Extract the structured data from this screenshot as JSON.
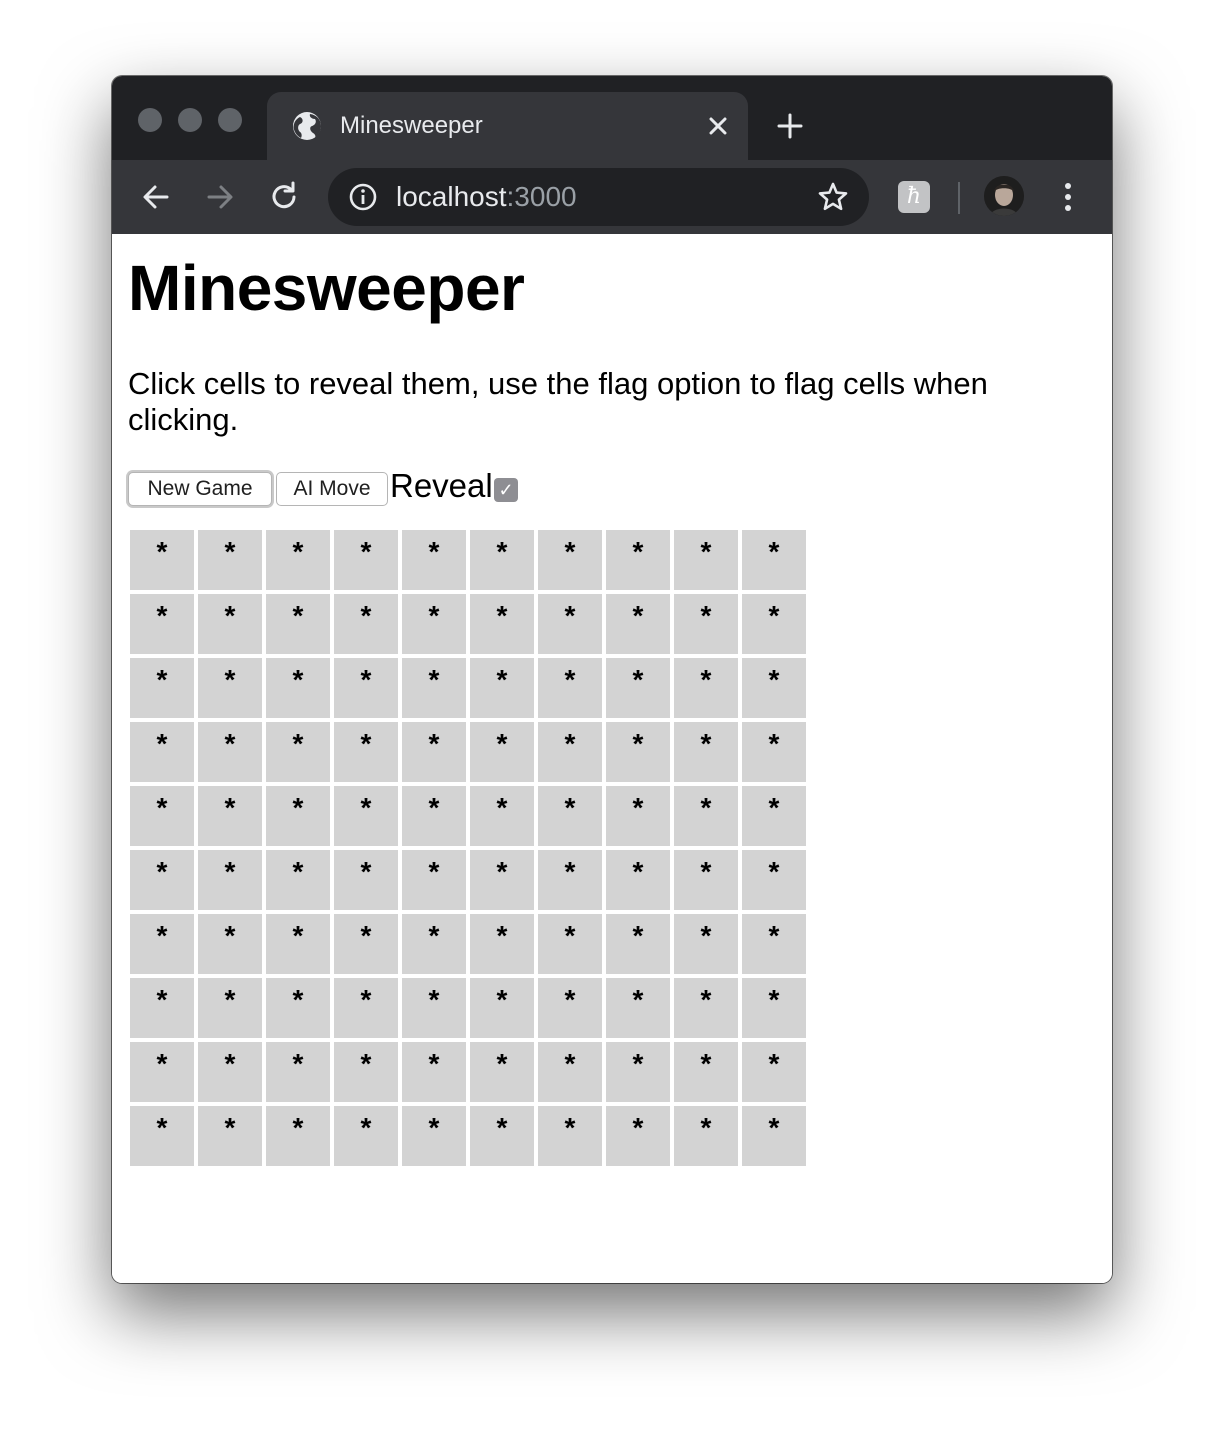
{
  "browser": {
    "tab_title": "Minesweeper",
    "url_host": "localhost",
    "url_port": ":3000",
    "icons": {
      "tab_favicon": "globe-icon",
      "tab_close": "close-icon",
      "new_tab": "plus-icon",
      "back": "arrow-left-icon",
      "forward": "arrow-right-icon",
      "reload": "reload-icon",
      "site_info": "info-icon",
      "bookmark": "star-icon",
      "extension": "extension-icon",
      "profile": "avatar",
      "menu": "kebab-icon"
    },
    "extension_glyph": "ħ"
  },
  "page": {
    "title": "Minesweeper",
    "instructions": "Click cells to reveal them, use the flag option to flag cells when clicking.",
    "controls": {
      "new_game_label": "New Game",
      "ai_move_label": "AI Move",
      "reveal_label": "Reveal",
      "reveal_checked": true,
      "reveal_check_glyph": "✓"
    },
    "board": {
      "rows": 10,
      "cols": 10,
      "cell_colors": {
        "hidden": "#d3d3d3"
      },
      "cells": [
        [
          "*",
          "*",
          "*",
          "*",
          "*",
          "*",
          "*",
          "*",
          "*",
          "*"
        ],
        [
          "*",
          "*",
          "*",
          "*",
          "*",
          "*",
          "*",
          "*",
          "*",
          "*"
        ],
        [
          "*",
          "*",
          "*",
          "*",
          "*",
          "*",
          "*",
          "*",
          "*",
          "*"
        ],
        [
          "*",
          "*",
          "*",
          "*",
          "*",
          "*",
          "*",
          "*",
          "*",
          "*"
        ],
        [
          "*",
          "*",
          "*",
          "*",
          "*",
          "*",
          "*",
          "*",
          "*",
          "*"
        ],
        [
          "*",
          "*",
          "*",
          "*",
          "*",
          "*",
          "*",
          "*",
          "*",
          "*"
        ],
        [
          "*",
          "*",
          "*",
          "*",
          "*",
          "*",
          "*",
          "*",
          "*",
          "*"
        ],
        [
          "*",
          "*",
          "*",
          "*",
          "*",
          "*",
          "*",
          "*",
          "*",
          "*"
        ],
        [
          "*",
          "*",
          "*",
          "*",
          "*",
          "*",
          "*",
          "*",
          "*",
          "*"
        ],
        [
          "*",
          "*",
          "*",
          "*",
          "*",
          "*",
          "*",
          "*",
          "*",
          "*"
        ]
      ]
    }
  }
}
